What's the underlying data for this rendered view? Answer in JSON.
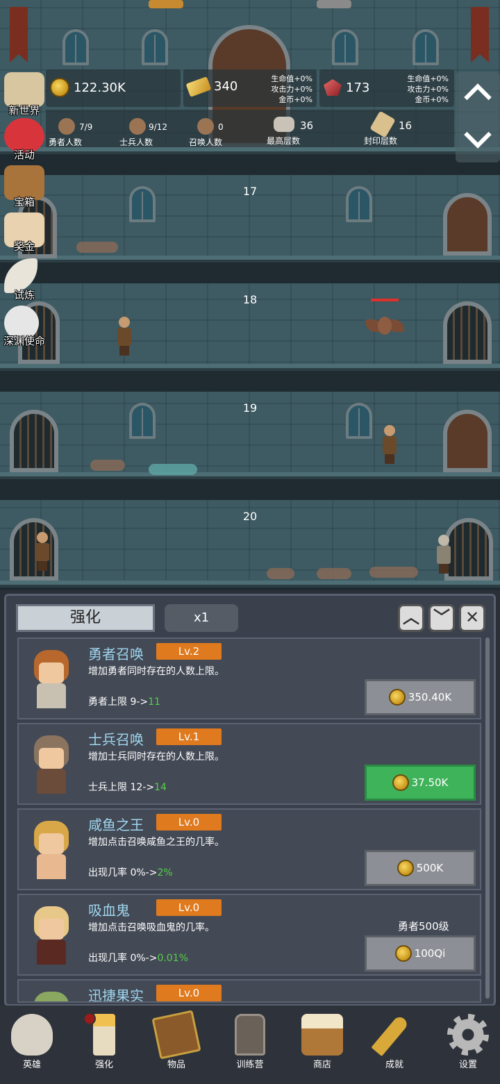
{
  "hud": {
    "gold": "122.30K",
    "bars": "340",
    "gems": "173",
    "bonus_left": [
      "生命值+0%",
      "攻击力+0%",
      "金币+0%"
    ],
    "bonus_right": [
      "生命值+0%",
      "攻击力+0%",
      "金币+0%"
    ],
    "hero_count": "7/9",
    "hero_label": "勇者人数",
    "soldier_count": "9/12",
    "soldier_label": "士兵人数",
    "summon_count": "0",
    "summon_label": "召唤人数",
    "max_floor": "36",
    "max_floor_label": "最高层数",
    "sealed_floor": "16",
    "sealed_floor_label": "封印层数"
  },
  "side_menu": [
    "新世界",
    "活动",
    "宝箱",
    "奖金",
    "试炼",
    "深渊使命"
  ],
  "floors": [
    "17",
    "18",
    "19",
    "20"
  ],
  "panel": {
    "title": "强化",
    "multiplier": "x1",
    "cards": [
      {
        "name": "勇者召唤",
        "level": "Lv.2",
        "desc": "增加勇者同时存在的人数上限。",
        "stat_prefix": "勇者上限 9->",
        "stat_up": "11",
        "cost": "350.40K",
        "affordable": false,
        "requirement": ""
      },
      {
        "name": "士兵召唤",
        "level": "Lv.1",
        "desc": "增加士兵同时存在的人数上限。",
        "stat_prefix": "士兵上限 12->",
        "stat_up": "14",
        "cost": "37.50K",
        "affordable": true,
        "requirement": ""
      },
      {
        "name": "咸鱼之王",
        "level": "Lv.0",
        "desc": "增加点击召唤咸鱼之王的几率。",
        "stat_prefix": "出现几率 0%->",
        "stat_up": "2%",
        "cost": "500K",
        "affordable": false,
        "requirement": ""
      },
      {
        "name": "吸血鬼",
        "level": "Lv.0",
        "desc": "增加点击召唤吸血鬼的几率。",
        "stat_prefix": "出现几率 0%->",
        "stat_up": "0.01%",
        "cost": "100Qi",
        "affordable": false,
        "requirement": "勇者500级"
      },
      {
        "name": "迅捷果实",
        "level": "Lv.0",
        "desc": "",
        "stat_prefix": "",
        "stat_up": "",
        "cost": "",
        "affordable": false,
        "requirement": ""
      }
    ]
  },
  "nav": [
    {
      "label": "英雄",
      "icon": "skull-icon"
    },
    {
      "label": "强化",
      "icon": "candle-icon"
    },
    {
      "label": "物品",
      "icon": "book-icon"
    },
    {
      "label": "训练营",
      "icon": "lantern-icon"
    },
    {
      "label": "商店",
      "icon": "beer-mug-icon"
    },
    {
      "label": "成就",
      "icon": "key-icon"
    },
    {
      "label": "设置",
      "icon": "gear-icon"
    }
  ],
  "colors": {
    "accent_orange": "#e07a1f",
    "buy_green": "#3fb35a",
    "upgrade_green": "#55d24a",
    "name_blue": "#9fd6ee"
  }
}
